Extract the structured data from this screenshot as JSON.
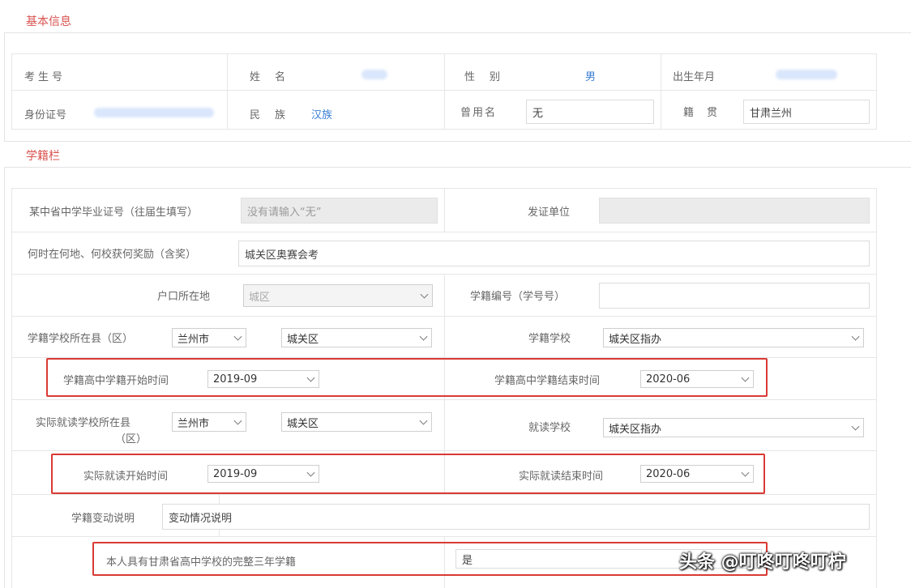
{
  "basic_info": {
    "title": "基本信息",
    "exam_no_label": "考生号",
    "name_label": "姓名",
    "gender_label": "性别",
    "gender_value": "男",
    "birth_label": "出生年月",
    "id_label": "身份证号",
    "ethnicity_label": "民族",
    "ethnicity_value": "汉族",
    "alias_label": "曾用名",
    "alias_value": "无",
    "origin_label": "籍贯",
    "origin_value": "甘肃兰州"
  },
  "school_status": {
    "title": "学籍栏",
    "cert_label": "某中省中学毕业证号（往届生填写）",
    "cert_placeholder": "没有请输入“无”",
    "issuer_label": "发证单位",
    "award_label": "何时在何地、何校获何奖励（含奖）",
    "award_value": "城关区奥赛会考",
    "residence_label": "户口所在地",
    "residence_value": "城区",
    "student_no_label": "学籍编号（学号号）",
    "school_location_label": "学籍学校所在县（区）",
    "city_value": "兰州市",
    "district_value": "城关区",
    "school_label": "学籍学校",
    "school_value": "城关区指办",
    "start_label": "学籍高中学籍开始时间",
    "start_value": "2019-09",
    "end_label": "学籍高中学籍结束时间",
    "end_value": "2020-06",
    "actual_location_label_1": "实际就读学校所在县",
    "actual_location_label_2": "（区）",
    "actual_city_value": "兰州市",
    "actual_district_value": "城关区",
    "actual_school_label": "就读学校",
    "actual_school_value": "城关区指办",
    "actual_start_label": "实际就读开始时间",
    "actual_start_value": "2019-09",
    "actual_end_label": "实际就读结束时间",
    "actual_end_value": "2020-06",
    "change_label": "学籍变动说明",
    "change_value": "变动情况说明",
    "three_year_label": "本人具有甘肃省高中学校的完整三年学籍",
    "three_year_value": "是"
  },
  "watermark": "头条 @叮咚叮咚叮柠"
}
